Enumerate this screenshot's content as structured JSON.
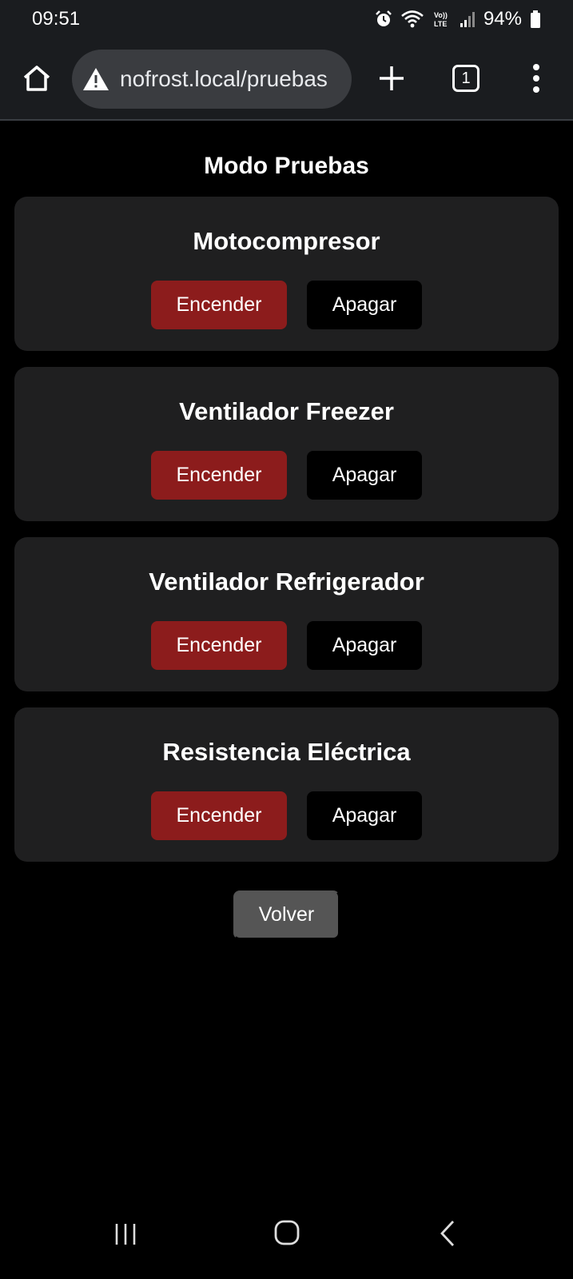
{
  "statusbar": {
    "time": "09:51",
    "network_label": "Vo)) LTE",
    "battery": "94%",
    "icons": [
      "alarm-icon",
      "wifi-icon",
      "volte-icon",
      "signal-icon",
      "battery-icon"
    ]
  },
  "browser": {
    "url": "nofrost.local/pruebas",
    "tab_count": "1",
    "icons": [
      "home-icon",
      "warning-icon",
      "plus-icon",
      "tabs-icon",
      "more-vert-icon"
    ]
  },
  "page": {
    "title": "Modo Pruebas",
    "cards": [
      {
        "title": "Motocompresor",
        "on_label": "Encender",
        "off_label": "Apagar"
      },
      {
        "title": "Ventilador Freezer",
        "on_label": "Encender",
        "off_label": "Apagar"
      },
      {
        "title": "Ventilador Refrigerador",
        "on_label": "Encender",
        "off_label": "Apagar"
      },
      {
        "title": "Resistencia Eléctrica",
        "on_label": "Encender",
        "off_label": "Apagar"
      }
    ],
    "back_label": "Volver"
  },
  "colors": {
    "on_button": "#8c1c1c",
    "off_button": "#000000",
    "back_button": "#555555",
    "card_bg": "#1f1f20",
    "chrome_bg": "#1a1c1f"
  }
}
